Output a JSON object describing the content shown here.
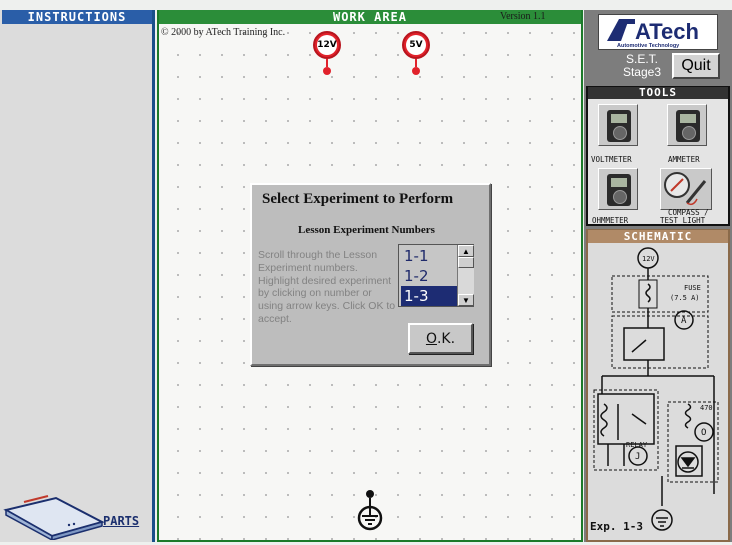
{
  "instructions": {
    "header": "INSTRUCTIONS",
    "parts_label": "PARTS"
  },
  "work_area": {
    "title": "WORK AREA",
    "version": "Version 1.1",
    "copyright": "© 2000 by ATech Training Inc.",
    "sources": [
      "12V",
      "5V"
    ]
  },
  "dialog": {
    "title": "Select Experiment to Perform",
    "subtitle": "Lesson Experiment Numbers",
    "help_text": "Scroll through the Lesson Experiment numbers. Highlight desired experiment by clicking on number or using arrow keys. Click OK to accept.",
    "list_items": [
      "1-1",
      "1-2",
      "1-3"
    ],
    "selected_item": "1-3",
    "ok_underlined": "O",
    "ok_rest": ".K."
  },
  "right_panel": {
    "logo_text": "ATech",
    "logo_sub": "Automotive Technology",
    "set_line1": "S.E.T.",
    "set_line2": "Stage3",
    "quit_label": "Quit",
    "tools_header": "TOOLS",
    "tools": [
      "VOLTMETER",
      "AMMETER",
      "OHMMETER",
      "COMPASS /",
      "TEST LIGHT"
    ],
    "schematic_header": "SCHEMATIC",
    "schematic_labels": {
      "source": "12V",
      "fuse1": "FUSE",
      "fuse2": "(7.5 A)",
      "meter_a": "A",
      "resistor": "470",
      "meter_o": "O",
      "relay": "RELAY",
      "relay_j": "J"
    },
    "experiment_label": "Exp. 1-3"
  },
  "colors": {
    "instr_blue": "#2a5ea8",
    "work_green": "#2b8d39",
    "source_red": "#e1222b",
    "list_select": "#1d2c73"
  }
}
